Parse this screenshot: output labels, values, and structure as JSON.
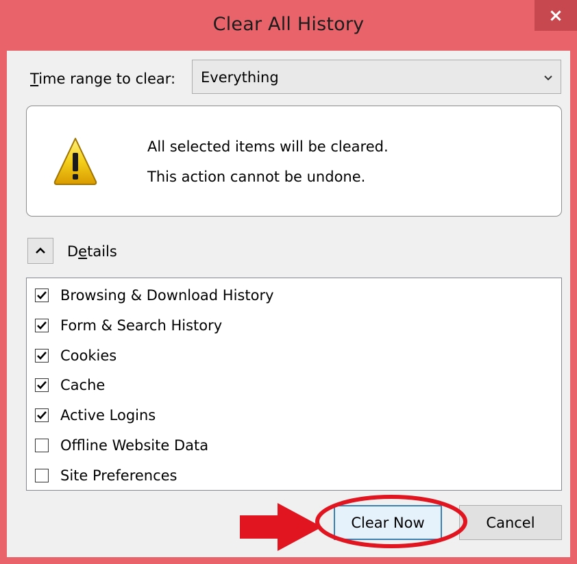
{
  "window": {
    "title": "Clear All History",
    "close_label": "×"
  },
  "time_range": {
    "label_underlined": "T",
    "label_rest": "ime range to clear:",
    "selected_value": "Everything"
  },
  "warning": {
    "icon": "warning-triangle-icon",
    "line1": "All selected items will be cleared.",
    "line2": "This action cannot be undone."
  },
  "details": {
    "label_part1": "D",
    "label_underlined": "e",
    "label_part2": "tails",
    "expanded": true
  },
  "items": [
    {
      "label": "Browsing & Download History",
      "checked": true
    },
    {
      "label": "Form & Search History",
      "checked": true
    },
    {
      "label": "Cookies",
      "checked": true
    },
    {
      "label": "Cache",
      "checked": true
    },
    {
      "label": "Active Logins",
      "checked": true
    },
    {
      "label": "Offline Website Data",
      "checked": false
    },
    {
      "label": "Site Preferences",
      "checked": false
    }
  ],
  "buttons": {
    "clear_now": "Clear Now",
    "cancel": "Cancel"
  },
  "annotations": {
    "highlight_color": "#e0151f"
  }
}
